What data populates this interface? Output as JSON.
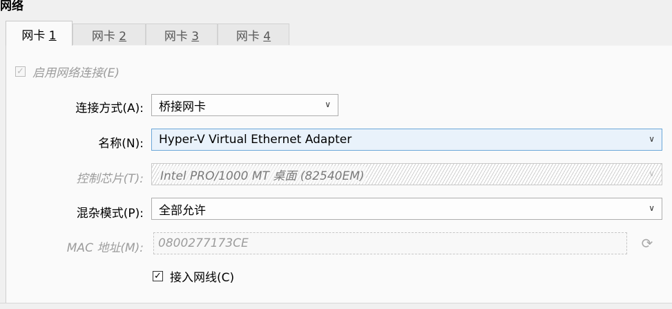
{
  "section_title": "网络",
  "tabs": [
    {
      "prefix": "网卡 ",
      "num": "1",
      "active": true
    },
    {
      "prefix": "网卡 ",
      "num": "2",
      "active": false
    },
    {
      "prefix": "网卡 ",
      "num": "3",
      "active": false
    },
    {
      "prefix": "网卡 ",
      "num": "4",
      "active": false
    }
  ],
  "enable_network": {
    "label": "启用网络连接(E)",
    "checked": true,
    "disabled": true
  },
  "attached_to": {
    "label": "连接方式(A):",
    "value": "桥接网卡"
  },
  "name": {
    "label": "名称(N):",
    "value": "Hyper-V Virtual Ethernet Adapter"
  },
  "adapter_type": {
    "label": "控制芯片(T):",
    "value": "Intel PRO/1000 MT 桌面 (82540EM)"
  },
  "promiscuous": {
    "label": "混杂模式(P):",
    "value": "全部允许"
  },
  "mac": {
    "label": "MAC 地址(M):",
    "value": "0800277173CE"
  },
  "cable": {
    "label": "接入网线(C)",
    "checked": true
  },
  "icons": {
    "dropdown": "chevron-down-icon",
    "refresh": "refresh-icon",
    "check": "checkmark-icon"
  }
}
